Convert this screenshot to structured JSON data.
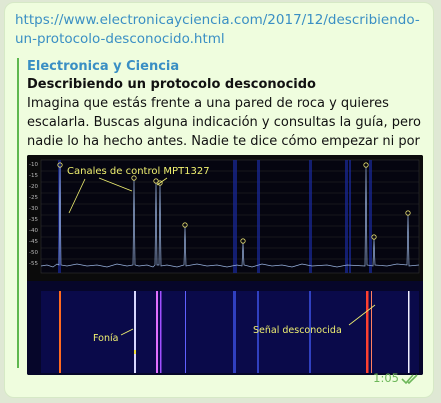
{
  "message": {
    "url": "https://www.electronicayciencia.com/2017/12/describiendo-un-protocolo-desconocido.html",
    "preview": {
      "site_name": "Electronica y Ciencia",
      "title": "Describiendo un protocolo desconocido",
      "description": "Imagina que estás frente a una pared de roca y quieres escalarla. Buscas alguna indicación y consultas la guía, pero nadie lo ha hecho antes. Nadie te dice cómo empezar ni por donde seguir, s..."
    },
    "image": {
      "spectrum_label": "Canales de control MPT1327",
      "voice_label": "Fonía",
      "unknown_label": "Señal desconocida",
      "y_ticks": [
        "-10",
        "-15",
        "-20",
        "-25",
        "-30",
        "-35",
        "-40",
        "-45",
        "-50",
        "-55"
      ]
    },
    "time": "1:05",
    "status_icon": "double-check-icon",
    "colors": {
      "link": "#3a8fc4",
      "accent_bar": "#5fb84f",
      "bubble": "#effdde",
      "check": "#6db75a"
    }
  }
}
